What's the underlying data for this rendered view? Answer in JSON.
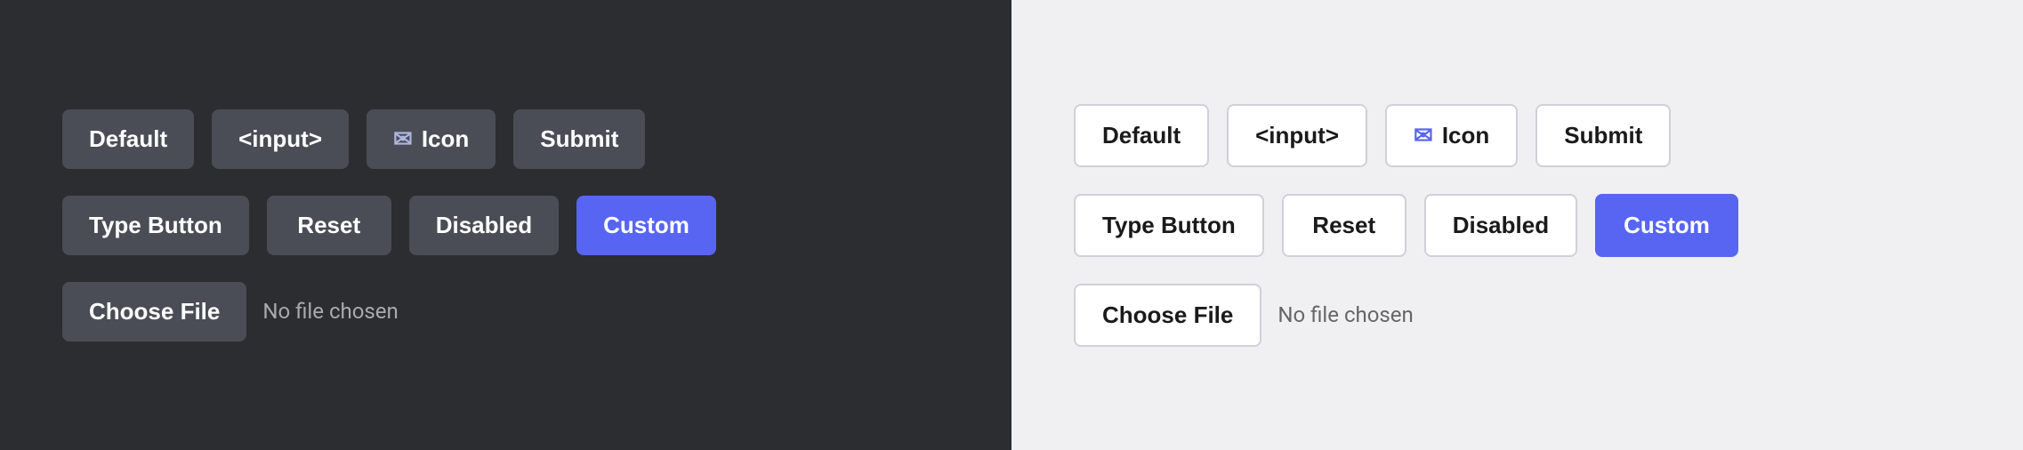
{
  "dark_panel": {
    "row1": {
      "btn1": "Default",
      "btn2": "<input>",
      "btn3_icon": "✉",
      "btn3_label": "Icon",
      "btn4": "Submit"
    },
    "row2": {
      "btn1": "Type Button",
      "btn2": "Reset",
      "btn3": "Disabled",
      "btn4": "Custom"
    },
    "file": {
      "choose": "Choose File",
      "status": "No file chosen"
    }
  },
  "light_panel": {
    "row1": {
      "btn1": "Default",
      "btn2": "<input>",
      "btn3_icon": "✉",
      "btn3_label": "Icon",
      "btn4": "Submit"
    },
    "row2": {
      "btn1": "Type Button",
      "btn2": "Reset",
      "btn3": "Disabled",
      "btn4": "Custom"
    },
    "file": {
      "choose": "Choose File",
      "status": "No file chosen"
    }
  }
}
